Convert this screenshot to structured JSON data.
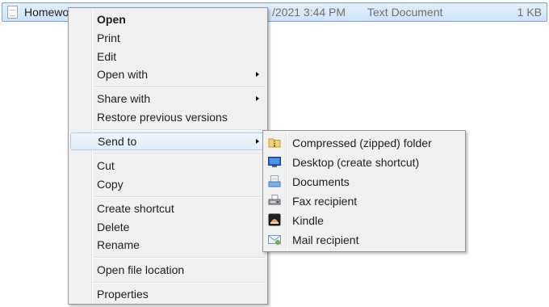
{
  "file_row": {
    "name": "Homewo",
    "date": "/2021 3:44 PM",
    "type": "Text Document",
    "size": "1 KB"
  },
  "context_menu": {
    "items": [
      {
        "label": "Open"
      },
      {
        "label": "Print"
      },
      {
        "label": "Edit"
      },
      {
        "label": "Open with"
      },
      {
        "label": "Share with"
      },
      {
        "label": "Restore previous versions"
      },
      {
        "label": "Send to"
      },
      {
        "label": "Cut"
      },
      {
        "label": "Copy"
      },
      {
        "label": "Create shortcut"
      },
      {
        "label": "Delete"
      },
      {
        "label": "Rename"
      },
      {
        "label": "Open file location"
      },
      {
        "label": "Properties"
      }
    ]
  },
  "send_to_menu": {
    "items": [
      {
        "label": "Compressed (zipped) folder",
        "icon": "zip-folder-icon"
      },
      {
        "label": "Desktop (create shortcut)",
        "icon": "desktop-icon"
      },
      {
        "label": "Documents",
        "icon": "documents-icon"
      },
      {
        "label": "Fax recipient",
        "icon": "fax-icon"
      },
      {
        "label": "Kindle",
        "icon": "kindle-icon"
      },
      {
        "label": "Mail recipient",
        "icon": "mail-icon"
      }
    ]
  },
  "colors": {
    "selection_fill": "#cce4fb",
    "selection_border": "#7da2ce",
    "menu_background": "#f0f0f0",
    "menu_border": "#979797",
    "hover_border": "#b0cbef"
  }
}
